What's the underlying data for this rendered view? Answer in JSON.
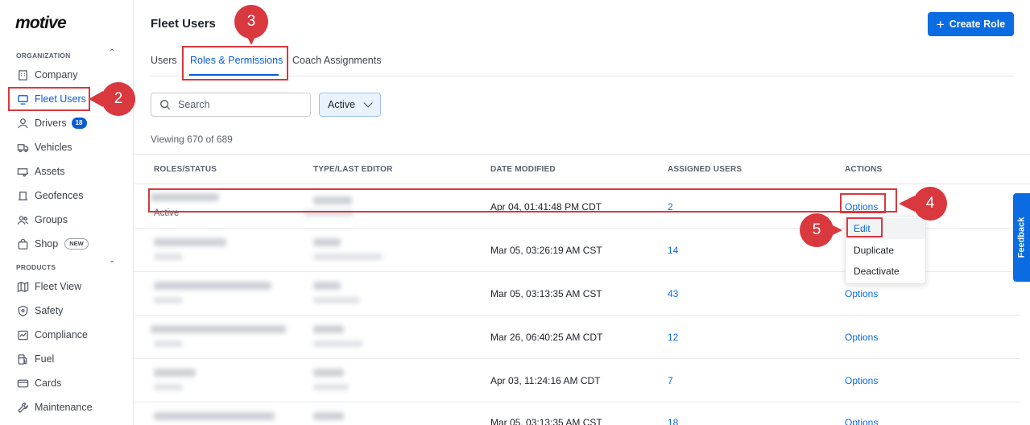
{
  "brand": {
    "logo": "motive"
  },
  "sidebar": {
    "organization_label": "ORGANIZATION",
    "products_label": "PRODUCTS",
    "items": [
      {
        "label": "Company",
        "icon": "building-icon"
      },
      {
        "label": "Fleet Users",
        "icon": "monitor-icon"
      },
      {
        "label": "Drivers",
        "icon": "person-icon",
        "badge": "18"
      },
      {
        "label": "Vehicles",
        "icon": "truck-icon"
      },
      {
        "label": "Assets",
        "icon": "trailer-icon"
      },
      {
        "label": "Geofences",
        "icon": "geofence-icon"
      },
      {
        "label": "Groups",
        "icon": "groups-icon"
      },
      {
        "label": "Shop",
        "icon": "shop-icon",
        "badge_new": "NEW"
      }
    ],
    "products": [
      {
        "label": "Fleet View",
        "icon": "map-icon"
      },
      {
        "label": "Safety",
        "icon": "shield-icon"
      },
      {
        "label": "Compliance",
        "icon": "compliance-icon"
      },
      {
        "label": "Fuel",
        "icon": "fuel-icon"
      },
      {
        "label": "Cards",
        "icon": "card-icon"
      },
      {
        "label": "Maintenance",
        "icon": "wrench-icon"
      }
    ]
  },
  "header": {
    "title": "Fleet Users",
    "create_button": "Create Role"
  },
  "tabs": [
    {
      "label": "Users"
    },
    {
      "label": "Roles & Permissions",
      "active": true
    },
    {
      "label": "Coach Assignments"
    }
  ],
  "search": {
    "placeholder": "Search"
  },
  "filter": {
    "value": "Active"
  },
  "viewing": "Viewing 670 of 689",
  "table": {
    "columns": [
      "ROLES/STATUS",
      "TYPE/LAST EDITOR",
      "DATE MODIFIED",
      "ASSIGNED USERS",
      "ACTIONS"
    ],
    "rows": [
      {
        "status": "Active",
        "date": "Apr 04, 01:41:48 PM CDT",
        "users": "2",
        "action": "Options"
      },
      {
        "status": "",
        "date": "Mar 05, 03:26:19 AM CST",
        "users": "14",
        "action": ""
      },
      {
        "status": "",
        "date": "Mar 05, 03:13:35 AM CST",
        "users": "43",
        "action": "Options"
      },
      {
        "status": "",
        "date": "Mar 26, 06:40:25 AM CDT",
        "users": "12",
        "action": "Options"
      },
      {
        "status": "",
        "date": "Apr 03, 11:24:16 AM CDT",
        "users": "7",
        "action": "Options"
      },
      {
        "status": "",
        "date": "Mar 05, 03:13:35 AM CST",
        "users": "18",
        "action": "Options"
      }
    ]
  },
  "dropdown": {
    "items": [
      "Edit",
      "Duplicate",
      "Deactivate"
    ]
  },
  "feedback": "Feedback",
  "annotations": {
    "m2": "2",
    "m3": "3",
    "m4": "4",
    "m5": "5"
  },
  "colors": {
    "accent": "#0a6ce0",
    "annotation": "#d9383e"
  }
}
